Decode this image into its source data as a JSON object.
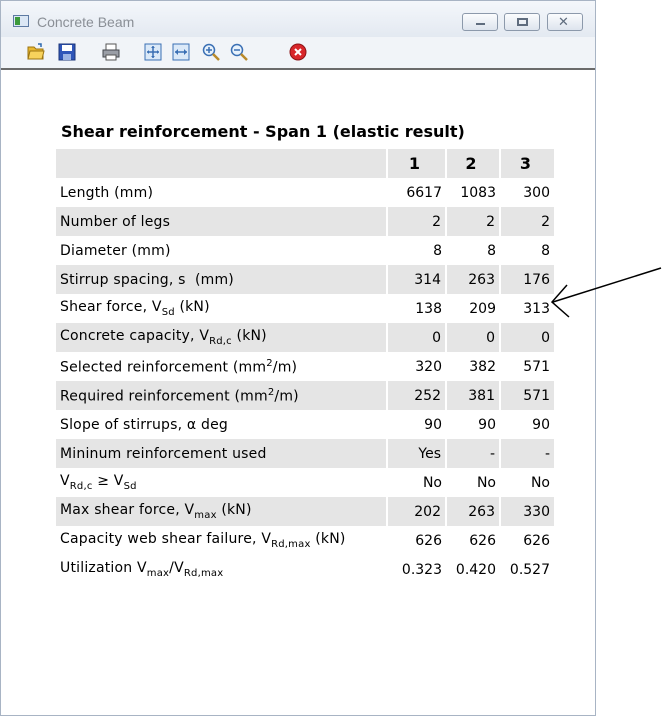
{
  "window": {
    "title": "Concrete Beam"
  },
  "toolbar": {
    "buttons": [
      {
        "icon": "open-folder-icon"
      },
      {
        "icon": "save-icon"
      },
      {
        "icon": "print-icon"
      },
      {
        "icon": "fit-page-icon"
      },
      {
        "icon": "fit-width-icon"
      },
      {
        "icon": "zoom-in-icon"
      },
      {
        "icon": "zoom-out-icon"
      },
      {
        "icon": "close-red-icon"
      }
    ]
  },
  "report": {
    "heading": "Shear reinforcement - Span 1 (elastic result)",
    "columns": [
      "1",
      "2",
      "3"
    ],
    "rows": [
      {
        "label": "Length (mm)",
        "values": [
          "6617",
          "1083",
          "300"
        ]
      },
      {
        "label": "Number of legs",
        "values": [
          "2",
          "2",
          "2"
        ]
      },
      {
        "label": "Diameter (mm)",
        "values": [
          "8",
          "8",
          "8"
        ]
      },
      {
        "label": "Stirrup spacing, s  (mm)",
        "values": [
          "314",
          "263",
          "176"
        ]
      },
      {
        "label_parts": [
          "Shear force, V",
          "Sd",
          " (kN)"
        ],
        "values": [
          "138",
          "209",
          "313"
        ]
      },
      {
        "label_parts": [
          "Concrete capacity, V",
          "Rd,c",
          " (kN)"
        ],
        "values": [
          "0",
          "0",
          "0"
        ]
      },
      {
        "label_parts": [
          "Selected reinforcement (mm",
          "2",
          "/m)"
        ],
        "values": [
          "320",
          "382",
          "571"
        ]
      },
      {
        "label_parts": [
          "Required reinforcement (mm",
          "2",
          "/m)"
        ],
        "values": [
          "252",
          "381",
          "571"
        ]
      },
      {
        "label": "Slope of stirrups, α deg",
        "values": [
          "90",
          "90",
          "90"
        ]
      },
      {
        "label": "Mininum reinforcement used",
        "values": [
          "Yes",
          "-",
          "-"
        ]
      },
      {
        "label_parts": [
          "V",
          "Rd,c",
          " ≥ V",
          "Sd"
        ],
        "values": [
          "No",
          "No",
          "No"
        ]
      },
      {
        "label_parts": [
          "Max shear force, V",
          "max",
          " (kN)"
        ],
        "values": [
          "202",
          "263",
          "330"
        ]
      },
      {
        "label_parts": [
          "Capacity web shear failure, V",
          "Rd,max",
          " (kN)"
        ],
        "values": [
          "626",
          "626",
          "626"
        ]
      },
      {
        "label_parts": [
          "Utilization V",
          "max",
          "/V",
          "Rd,max"
        ],
        "values": [
          "0.323",
          "0.420",
          "0.527"
        ]
      }
    ]
  },
  "colors": {
    "row_shade": "#e5e5e5",
    "title_text": "#8a8f96",
    "close_red": "#d8262a"
  }
}
